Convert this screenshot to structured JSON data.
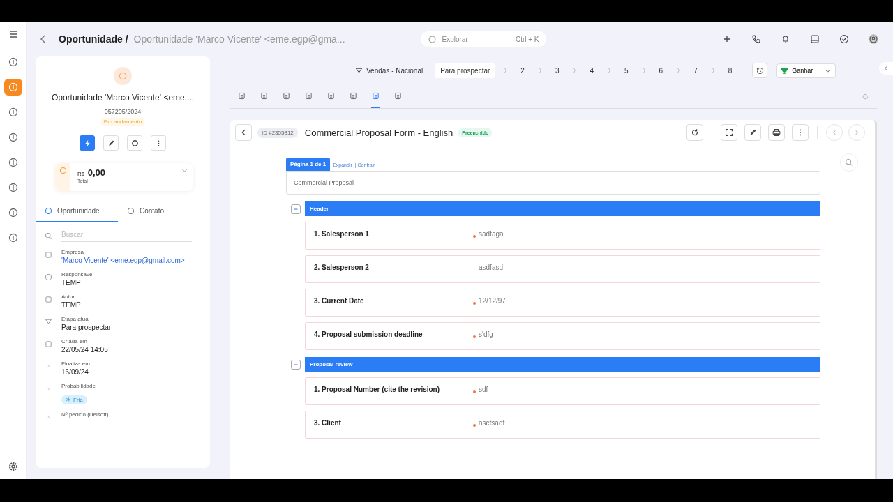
{
  "breadcrumb": {
    "root": "Oportunidade /",
    "current": "Oportunidade 'Marco Vicente' <eme.egp@gma..."
  },
  "search": {
    "placeholder": "Explorar",
    "shortcut": "Ctrl + K"
  },
  "nav": [
    {
      "selected": false
    },
    {
      "selected": true
    },
    {
      "selected": false
    },
    {
      "selected": false
    },
    {
      "selected": false
    },
    {
      "selected": false
    },
    {
      "selected": false
    },
    {
      "selected": false
    }
  ],
  "record": {
    "title": "Oportunidade 'Marco Vicente' <eme....",
    "code": "057205/2024",
    "status": "Em andamento",
    "currency": "R$",
    "total": "0,00",
    "total_label": "Total"
  },
  "panel_tabs": [
    {
      "label": "Oportunidade",
      "selected": true
    },
    {
      "label": "Contato",
      "selected": false
    }
  ],
  "panel_search": {
    "placeholder": "Buscar"
  },
  "details": [
    {
      "label": "Empresa",
      "value": "'Marco Vicente' <eme.egp@gmail.com>",
      "kind": "link"
    },
    {
      "label": "Responsável",
      "value": "TEMP",
      "kind": "text"
    },
    {
      "label": "Autor",
      "value": "TEMP",
      "kind": "text"
    },
    {
      "label": "Etapa atual",
      "value": "Para prospectar",
      "kind": "text"
    },
    {
      "label": "Criada em",
      "value": "22/05/24 14:05",
      "kind": "text"
    },
    {
      "label": "Finaliza em",
      "value": "16/09/24",
      "kind": "text"
    },
    {
      "label": "Probabilidade",
      "value": "Fria",
      "kind": "tag"
    },
    {
      "label": "Nº pedido (Delsoft)"
    }
  ],
  "pipeline": {
    "name": "Vendas - Nacional",
    "stages": [
      {
        "label": "Para prospectar",
        "selected": true
      },
      {
        "label": "2",
        "selected": false
      },
      {
        "label": "3",
        "selected": false
      },
      {
        "label": "4",
        "selected": false
      },
      {
        "label": "5",
        "selected": false
      },
      {
        "label": "6",
        "selected": false
      },
      {
        "label": "7",
        "selected": false
      },
      {
        "label": "8",
        "selected": false
      }
    ],
    "win": "Ganhar"
  },
  "content_tabs": [
    {
      "selected": false
    },
    {
      "selected": false
    },
    {
      "selected": false
    },
    {
      "selected": false
    },
    {
      "selected": false
    },
    {
      "selected": false
    },
    {
      "selected": true
    },
    {
      "selected": false
    }
  ],
  "form": {
    "id": "ID #2355812",
    "title": "Commercial Proposal Form - English",
    "status": "Preenchido",
    "page": "Página 1 de 1",
    "expand": "Expandir",
    "collapse": "| Contrair",
    "name": "Commercial Proposal",
    "sections": [
      {
        "title": "Header",
        "expanded": true,
        "fields": [
          {
            "label": "1. Salesperson 1",
            "value": "sadfaga",
            "required": true
          },
          {
            "label": "2. Salesperson 2",
            "value": "asdfasd",
            "required": false
          },
          {
            "label": "3. Current Date",
            "value": "12/12/97",
            "required": true
          },
          {
            "label": "4. Proposal submission deadline",
            "value": "s'dfg",
            "required": true
          }
        ]
      },
      {
        "title": "Proposal review",
        "expanded": true,
        "fields": [
          {
            "label": "1. Proposal Number (cite the revision)",
            "value": "sdf",
            "required": true
          },
          {
            "label": "3. Client",
            "value": "ascfsadf",
            "required": true
          }
        ]
      }
    ]
  }
}
